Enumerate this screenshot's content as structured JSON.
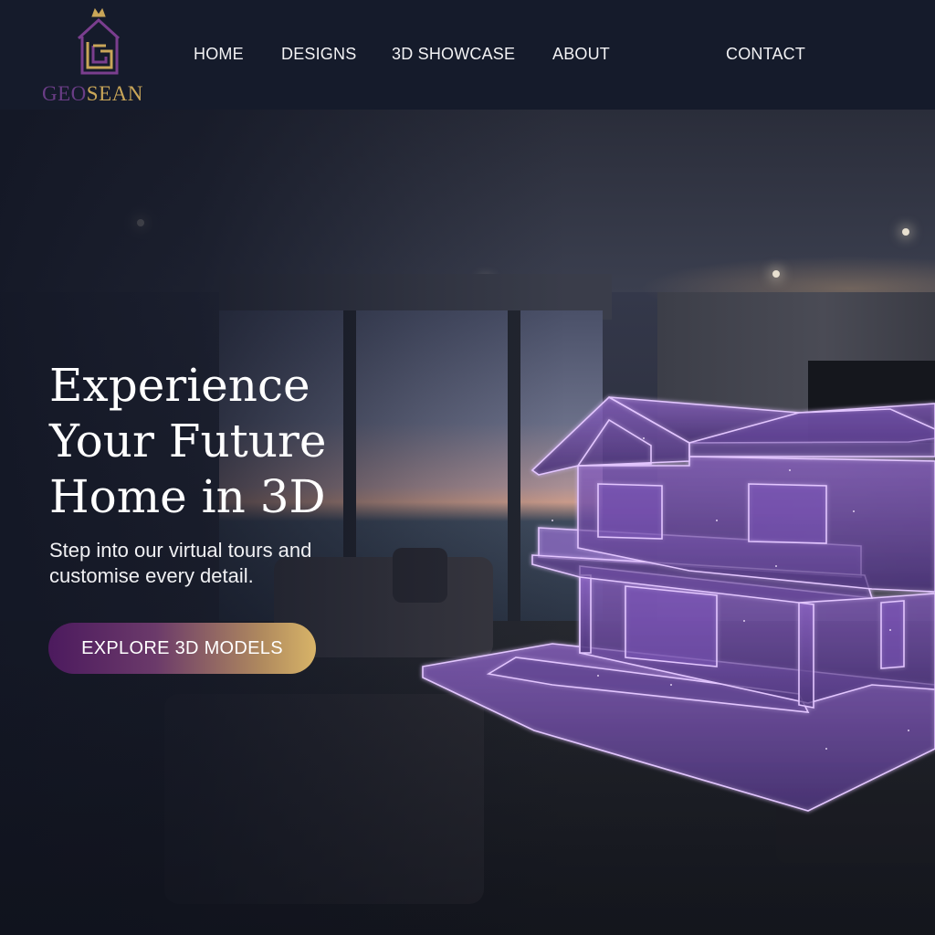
{
  "brand": {
    "name_part1": "GEO",
    "name_part2": "SEAN",
    "logo_mark": "crowned-house-g-monogram",
    "colors": {
      "purple": "#6a3d86",
      "gold": "#c9a658"
    }
  },
  "nav": {
    "items": [
      {
        "label": "HOME"
      },
      {
        "label": "DESIGNS"
      },
      {
        "label": "3D SHOWCASE"
      },
      {
        "label": "ABOUT"
      },
      {
        "label": "CONTACT"
      }
    ]
  },
  "hero": {
    "title_lines": [
      "Experience",
      "Your Future",
      "Home in 3D"
    ],
    "subtitle_lines": [
      "Step into our virtual tours and",
      "customise every detail."
    ],
    "cta_label": "EXPLORE 3D MODELS"
  },
  "theme": {
    "header_bg": "#151b2b",
    "cta_gradient_start": "#4c1a5e",
    "cta_gradient_end": "#d8b468",
    "hologram": "#b58ce0"
  }
}
